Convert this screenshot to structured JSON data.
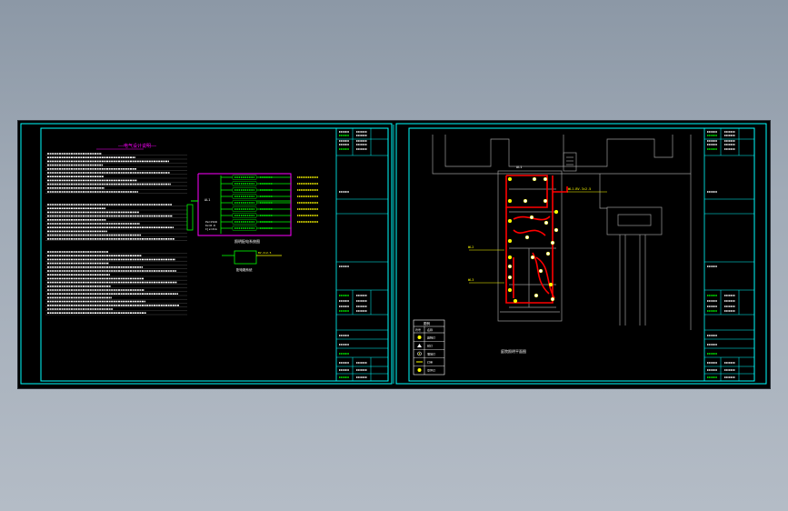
{
  "app": {
    "canvas_background": "#000000",
    "window_background": "#9aa5b1"
  },
  "colors": {
    "frame": "#00ffff",
    "text_white": "#ffffff",
    "text_yellow": "#ffff00",
    "text_green": "#00ff00",
    "magenta": "#ff00ff",
    "red": "#ff0000",
    "grey": "#9a9a9a"
  },
  "sheet1": {
    "notes_title": "——电气设计说明——",
    "schematic_label": "照明配电系统图",
    "legend_label": "配电箱系统"
  },
  "sheet2": {
    "plan_title": "庭院照明平面图",
    "legend_header": "图例",
    "legend_col_symbol": "符号",
    "legend_col_name": "名称",
    "legend_rows": [
      {
        "icon": "lamp-yellow",
        "name": "庭院灯"
      },
      {
        "icon": "uplight",
        "name": "射灯"
      },
      {
        "icon": "spot",
        "name": "埋地灯"
      },
      {
        "icon": "line",
        "name": "灯带"
      },
      {
        "icon": "circle-yellow",
        "name": "草坪灯"
      }
    ]
  }
}
